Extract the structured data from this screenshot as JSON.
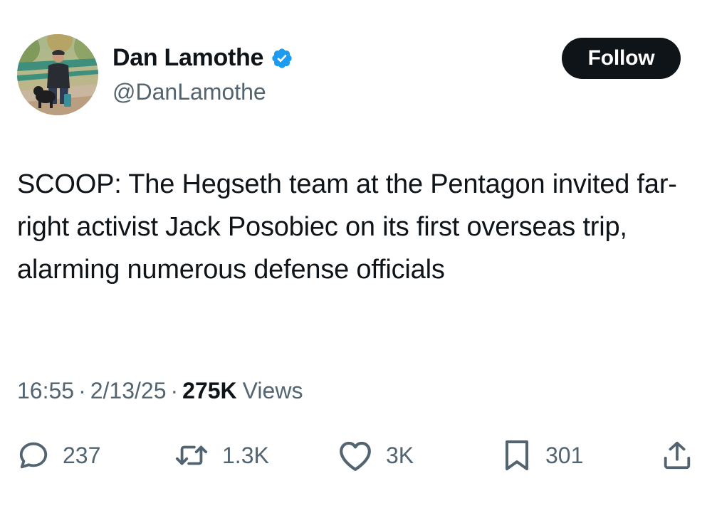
{
  "author": {
    "display_name": "Dan Lamothe",
    "handle": "@DanLamothe",
    "verified_icon": "verified-badge-icon",
    "avatar_icon": "avatar-photo"
  },
  "follow_button": {
    "label": "Follow"
  },
  "tweet": {
    "text": "SCOOP: The Hegseth team at the Pentagon invited far-right activist Jack Posobiec on its first overseas trip, alarming numerous defense officials"
  },
  "meta": {
    "time": "16:55",
    "date": "2/13/25",
    "separator": "·",
    "views_count": "275K",
    "views_label": "Views"
  },
  "actions": {
    "reply": {
      "icon": "reply-icon",
      "count": "237"
    },
    "retweet": {
      "icon": "retweet-icon",
      "count": "1.3K"
    },
    "like": {
      "icon": "heart-icon",
      "count": "3K"
    },
    "bookmark": {
      "icon": "bookmark-icon",
      "count": "301"
    },
    "share": {
      "icon": "share-icon"
    }
  },
  "colors": {
    "text_primary": "#0f1419",
    "text_secondary": "#536471",
    "verified_blue": "#1d9bf0",
    "button_bg": "#0f1419",
    "button_text": "#ffffff"
  }
}
